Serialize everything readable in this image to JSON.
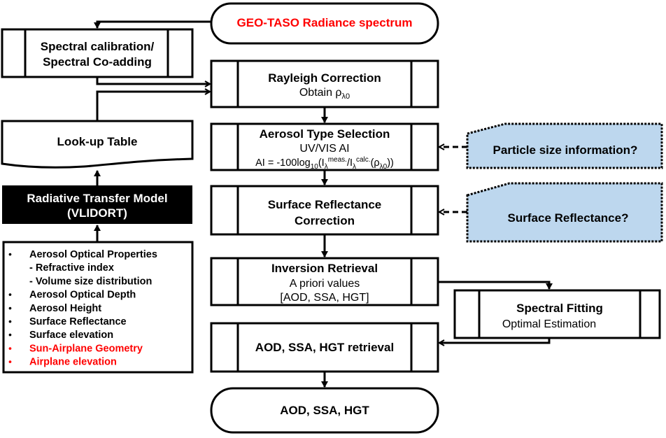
{
  "nodes": {
    "source": "GEO-TASO Radiance spectrum",
    "calibration": [
      "Spectral calibration/",
      "Spectral Co-adding"
    ],
    "rayleigh": {
      "title": "Rayleigh Correction",
      "sub": "Obtain ρ",
      "sub_subscript": "λ0"
    },
    "aerosol_type": {
      "title": "Aerosol Type Selection",
      "sub": "UV/VIS AI",
      "formula": "AI = -100log10(Iλmeas./Iλcalc.(ρλ0))"
    },
    "surface": [
      "Surface Reflectance",
      "Correction"
    ],
    "inversion": {
      "title": "Inversion Retrieval",
      "line2": "A priori values",
      "line3": "[AOD, SSA, HGT]"
    },
    "fitting": {
      "title": "Spectral Fitting",
      "sub": "Optimal Estimation"
    },
    "retrieval": "AOD, SSA, HGT retrieval",
    "output": "AOD, SSA, HGT",
    "lut": "Look-up Table",
    "rtm": [
      "Radiative Transfer Model",
      "(VLIDORT)"
    ],
    "particle_q": "Particle size information?",
    "surface_q": "Surface Reflectance?"
  },
  "inputs": [
    {
      "bullet": "•",
      "text": "Aerosol Optical Properties",
      "color": "#000000"
    },
    {
      "bullet": "",
      "text": "- Refractive index",
      "color": "#000000"
    },
    {
      "bullet": "",
      "text": "- Volume size distribution",
      "color": "#000000"
    },
    {
      "bullet": "•",
      "text": "Aerosol Optical Depth",
      "color": "#000000"
    },
    {
      "bullet": "•",
      "text": "Aerosol Height",
      "color": "#000000"
    },
    {
      "bullet": "•",
      "text": "Surface Reflectance",
      "color": "#000000"
    },
    {
      "bullet": "•",
      "text": "Surface elevation",
      "color": "#000000"
    },
    {
      "bullet": "•",
      "text": "Sun-Airplane Geometry",
      "color": "#ff0000"
    },
    {
      "bullet": "•",
      "text": "Airplane elevation",
      "color": "#ff0000"
    }
  ],
  "colors": {
    "highlight": "#ff0000",
    "callout_fill": "#bdd7ee",
    "rtm_fill": "#000000"
  }
}
